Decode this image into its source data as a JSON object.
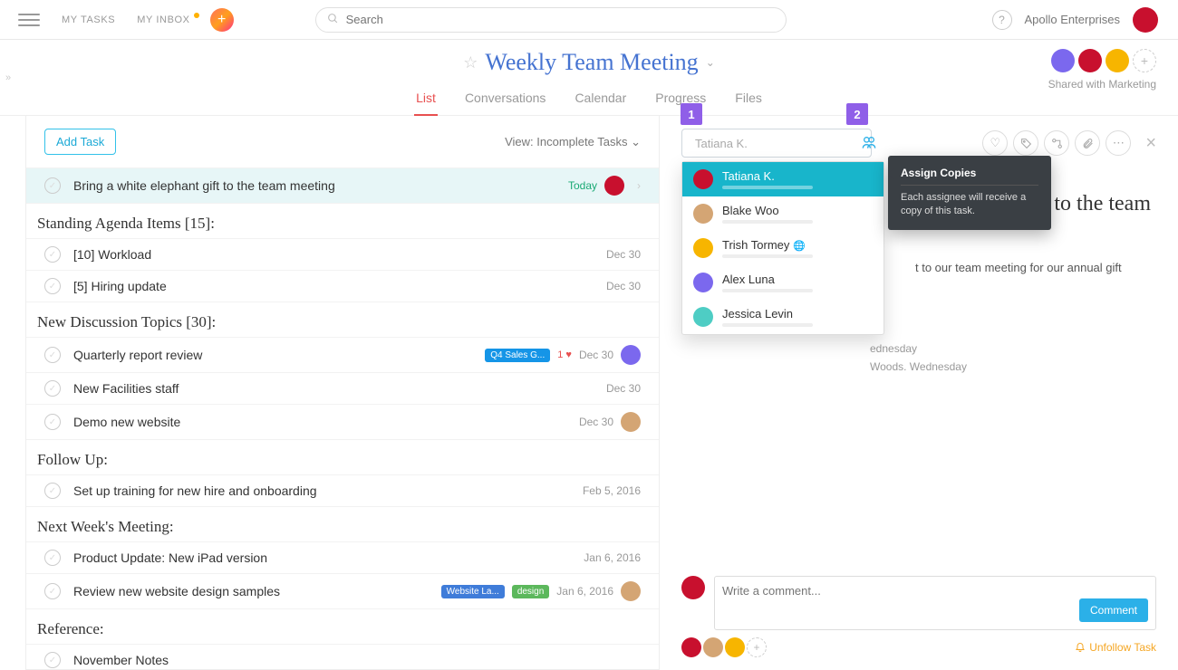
{
  "topbar": {
    "my_tasks": "MY TASKS",
    "my_inbox": "MY INBOX",
    "search_placeholder": "Search",
    "workspace": "Apollo Enterprises"
  },
  "project": {
    "title": "Weekly Team Meeting",
    "tabs": {
      "list": "List",
      "conversations": "Conversations",
      "calendar": "Calendar",
      "progress": "Progress",
      "files": "Files"
    },
    "shared_label": "Shared with Marketing"
  },
  "list": {
    "add_task": "Add Task",
    "view_label": "View: Incomplete Tasks",
    "sections": {
      "standing": "Standing Agenda Items [15]:",
      "new_discussion": "New Discussion Topics [30]:",
      "follow_up": "Follow Up:",
      "next_week": "Next Week's Meeting:",
      "reference": "Reference:"
    },
    "tasks": {
      "t0": {
        "name": "Bring a white elephant gift to the team meeting",
        "date": "Today"
      },
      "t1": {
        "name": "[10] Workload",
        "date": "Dec 30"
      },
      "t2": {
        "name": "[5] Hiring update",
        "date": "Dec 30"
      },
      "t3": {
        "name": "Quarterly report review",
        "date": "Dec 30",
        "tag": "Q4 Sales G...",
        "heart": "1"
      },
      "t4": {
        "name": "New Facilities staff",
        "date": "Dec 30"
      },
      "t5": {
        "name": "Demo new website",
        "date": "Dec 30"
      },
      "t6": {
        "name": "Set up training for new hire and onboarding",
        "date": "Feb 5, 2016"
      },
      "t7": {
        "name": "Product Update: New iPad version",
        "date": "Jan 6, 2016"
      },
      "t8": {
        "name": "Review new website design samples",
        "date": "Jan 6, 2016",
        "tag1": "Website La...",
        "tag2": "design"
      },
      "t9": {
        "name": "November Notes"
      }
    }
  },
  "detail": {
    "assignee_placeholder": "Tatiana K.",
    "title_fragment": "ift to the team",
    "desc_fragment": "t to our team meeting for our annual gift",
    "meta1": "ednesday",
    "meta2": "Woods.   Wednesday",
    "comment_placeholder": "Write a comment...",
    "comment_btn": "Comment",
    "unfollow": "Unfollow Task"
  },
  "dropdown": {
    "p0": "Tatiana K.",
    "p1": "Blake Woo",
    "p2": "Trish Tormey",
    "p3": "Alex Luna",
    "p4": "Jessica Levin"
  },
  "tooltip": {
    "title": "Assign Copies",
    "body": "Each assignee will receive a copy of this task."
  },
  "callouts": {
    "c1": "1",
    "c2": "2"
  }
}
